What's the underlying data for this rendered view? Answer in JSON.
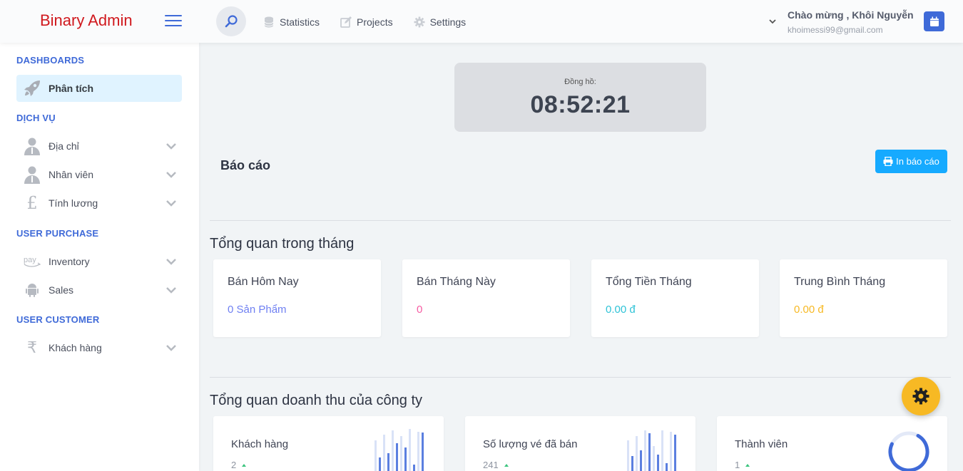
{
  "app": {
    "title": "Binary Admin"
  },
  "topnav": [
    {
      "label": "Statistics",
      "icon": "database-icon"
    },
    {
      "label": "Projects",
      "icon": "edit-icon"
    },
    {
      "label": "Settings",
      "icon": "gear-icon"
    }
  ],
  "user": {
    "greeting": "Chào mừng , Khôi Nguyễn",
    "email": "khoimessi99@gmail.com"
  },
  "sidebar": {
    "sections": [
      {
        "heading": "DASHBOARDS",
        "items": [
          {
            "label": "Phân tích",
            "icon": "rocket-icon",
            "active": true
          }
        ]
      },
      {
        "heading": "DỊCH VỤ",
        "items": [
          {
            "label": "Địa chỉ",
            "icon": "user-icon"
          },
          {
            "label": "Nhân viên",
            "icon": "user-icon"
          },
          {
            "label": "Tính lương",
            "icon": "pound-icon"
          }
        ]
      },
      {
        "heading": "USER PURCHASE",
        "items": [
          {
            "label": "Inventory",
            "icon": "pay-icon"
          },
          {
            "label": "Sales",
            "icon": "android-icon"
          }
        ]
      },
      {
        "heading": "USER CUSTOMER",
        "items": [
          {
            "label": "Khách hàng",
            "icon": "rupee-icon"
          }
        ]
      }
    ]
  },
  "clock": {
    "label": "Đồng hồ:",
    "time": "08:52:21"
  },
  "report": {
    "title": "Báo cáo",
    "print_label": "In báo cáo"
  },
  "overview": {
    "title": "Tổng quan trong tháng",
    "cards": [
      {
        "title": "Bán Hôm Nay",
        "value": "0 Sản Phẩm",
        "color": "#6f80f2"
      },
      {
        "title": "Bán Tháng Này",
        "value": "0",
        "color": "#f65ca2"
      },
      {
        "title": "Tổng Tiền Tháng",
        "value": "0.00 đ",
        "color": "#2fc3d7"
      },
      {
        "title": "Trung Bình Tháng",
        "value": "0.00 đ",
        "color": "#f7b924"
      }
    ]
  },
  "revenue": {
    "title": "Tổng quan doanh thu của công ty",
    "cards": [
      {
        "title": "Khách hàng",
        "value": "2"
      },
      {
        "title": "Số lượng vé đã bán",
        "value": "241"
      },
      {
        "title": "Thành viên",
        "value": "1"
      }
    ]
  },
  "colors": {
    "accent": "#3f6ad8",
    "brand": "#d0191e",
    "print_button": "#16aaff",
    "fab": "#f7b924"
  }
}
